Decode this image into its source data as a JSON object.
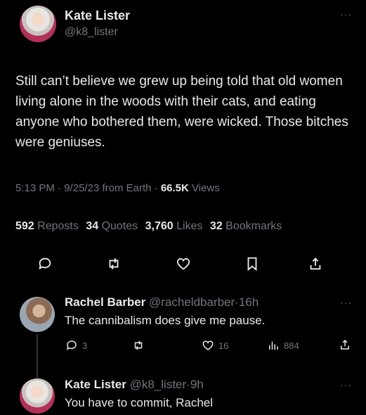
{
  "main_tweet": {
    "author_name": "Kate Lister",
    "author_handle": "@k8_lister",
    "text": "Still can’t believe we grew up being told that old women living alone in the woods with their cats, and eating anyone who bothered them, were wicked. Those bitches were geniuses.",
    "meta": {
      "time": "5:13 PM",
      "date": "9/25/23",
      "source": "from Earth",
      "views_value": "66.5K",
      "views_label": "Views",
      "sep": "·"
    },
    "stats": [
      {
        "value": "592",
        "label": "Reposts"
      },
      {
        "value": "34",
        "label": "Quotes"
      },
      {
        "value": "3,760",
        "label": "Likes"
      },
      {
        "value": "32",
        "label": "Bookmarks"
      }
    ],
    "actions": [
      "reply-icon",
      "repost-icon",
      "like-icon",
      "bookmark-icon",
      "share-icon"
    ],
    "more": "···"
  },
  "replies": [
    {
      "author_name": "Rachel Barber",
      "author_handle": "@racheldbarber",
      "age": "16h",
      "sep": "·",
      "text": "The cannibalism does give me pause.",
      "more": "···",
      "counts": {
        "replies": "3",
        "likes": "16",
        "views": "884"
      }
    },
    {
      "author_name": "Kate Lister",
      "author_handle": "@k8_lister",
      "age": "9h",
      "sep": "·",
      "text": "You have to commit, Rachel",
      "more": "···"
    }
  ],
  "colors": {
    "background": "#000000",
    "text": "#e7e9ea",
    "muted": "#71767b"
  }
}
